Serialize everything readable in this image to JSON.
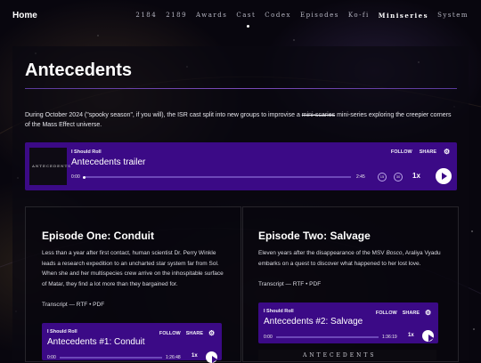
{
  "nav": {
    "home": "Home",
    "items": [
      "2184",
      "2189",
      "Awards",
      "Cast",
      "Codex",
      "Episodes",
      "Ko-fi",
      "Miniseries",
      "System"
    ],
    "active_index": 7
  },
  "page": {
    "title": "Antecedents",
    "intro_before": "During October 2024 (\"spooky season\", if you will), the ISR cast split into new groups to improvise a ",
    "intro_strike": "mini-scaries",
    "intro_after": " mini-series exploring the creepier corners of the Mass Effect universe."
  },
  "trailer_player": {
    "publisher": "I Should Roll",
    "title": "Antecedents trailer",
    "follow": "FOLLOW",
    "share": "SHARE",
    "time_current": "0:00",
    "time_total": "2:45",
    "skip_back": "15",
    "skip_fwd": "30",
    "speed": "1x",
    "art_label": "ANTECEDENTS",
    "progress": 0
  },
  "episodes": [
    {
      "title": "Episode One: Conduit",
      "description": "Less than a year after first contact, human scientist Dr. Perry Winkle leads a research expedition to an uncharted star system far from Sol. When she and her multispecies crew arrive on the inhospitable surface of Matar, they find a lot more than they bargained for.",
      "links": "Transcript — RTF • PDF",
      "player": {
        "publisher": "I Should Roll",
        "title": "Antecedents #1: Conduit",
        "follow": "FOLLOW",
        "share": "SHARE",
        "time_current": "0:00",
        "time_total": "1:26:48",
        "speed": "1x"
      }
    },
    {
      "title": "Episode Two: Salvage",
      "description_before": "Eleven years after the disappearance of the MSV ",
      "description_italic": "Bosco",
      "description_after": ", Araliya Vyadu embarks on a quest to discover what happened to her lost love.",
      "links": "Transcript — RTF • PDF",
      "player": {
        "publisher": "I Should Roll",
        "title": "Antecedents #2: Salvage",
        "follow": "FOLLOW",
        "share": "SHARE",
        "time_current": "0:00",
        "time_total": "1:36:19",
        "speed": "1x"
      },
      "art_label": "ANTECEDENTS"
    }
  ],
  "colors": {
    "player_bg": "#3b0a86",
    "accent": "#6d48b8",
    "background": "#07050c"
  }
}
